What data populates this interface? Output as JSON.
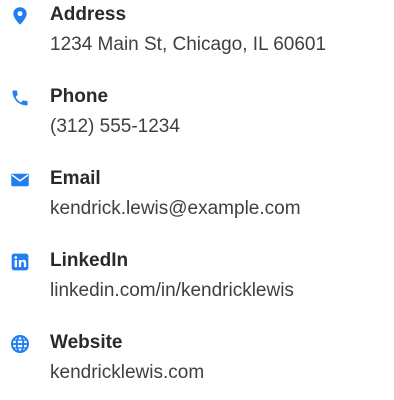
{
  "colors": {
    "icon": "#1e7ef2",
    "label": "#2a2a2a",
    "value": "#3f3f3f"
  },
  "contacts": [
    {
      "icon": "map-pin-icon",
      "label": "Address",
      "value": "1234 Main St, Chicago, IL 60601"
    },
    {
      "icon": "phone-icon",
      "label": "Phone",
      "value": "(312) 555-1234"
    },
    {
      "icon": "envelope-icon",
      "label": "Email",
      "value": "kendrick.lewis@example.com"
    },
    {
      "icon": "linkedin-icon",
      "label": "LinkedIn",
      "value": "linkedin.com/in/kendricklewis"
    },
    {
      "icon": "globe-icon",
      "label": "Website",
      "value": "kendricklewis.com"
    }
  ]
}
